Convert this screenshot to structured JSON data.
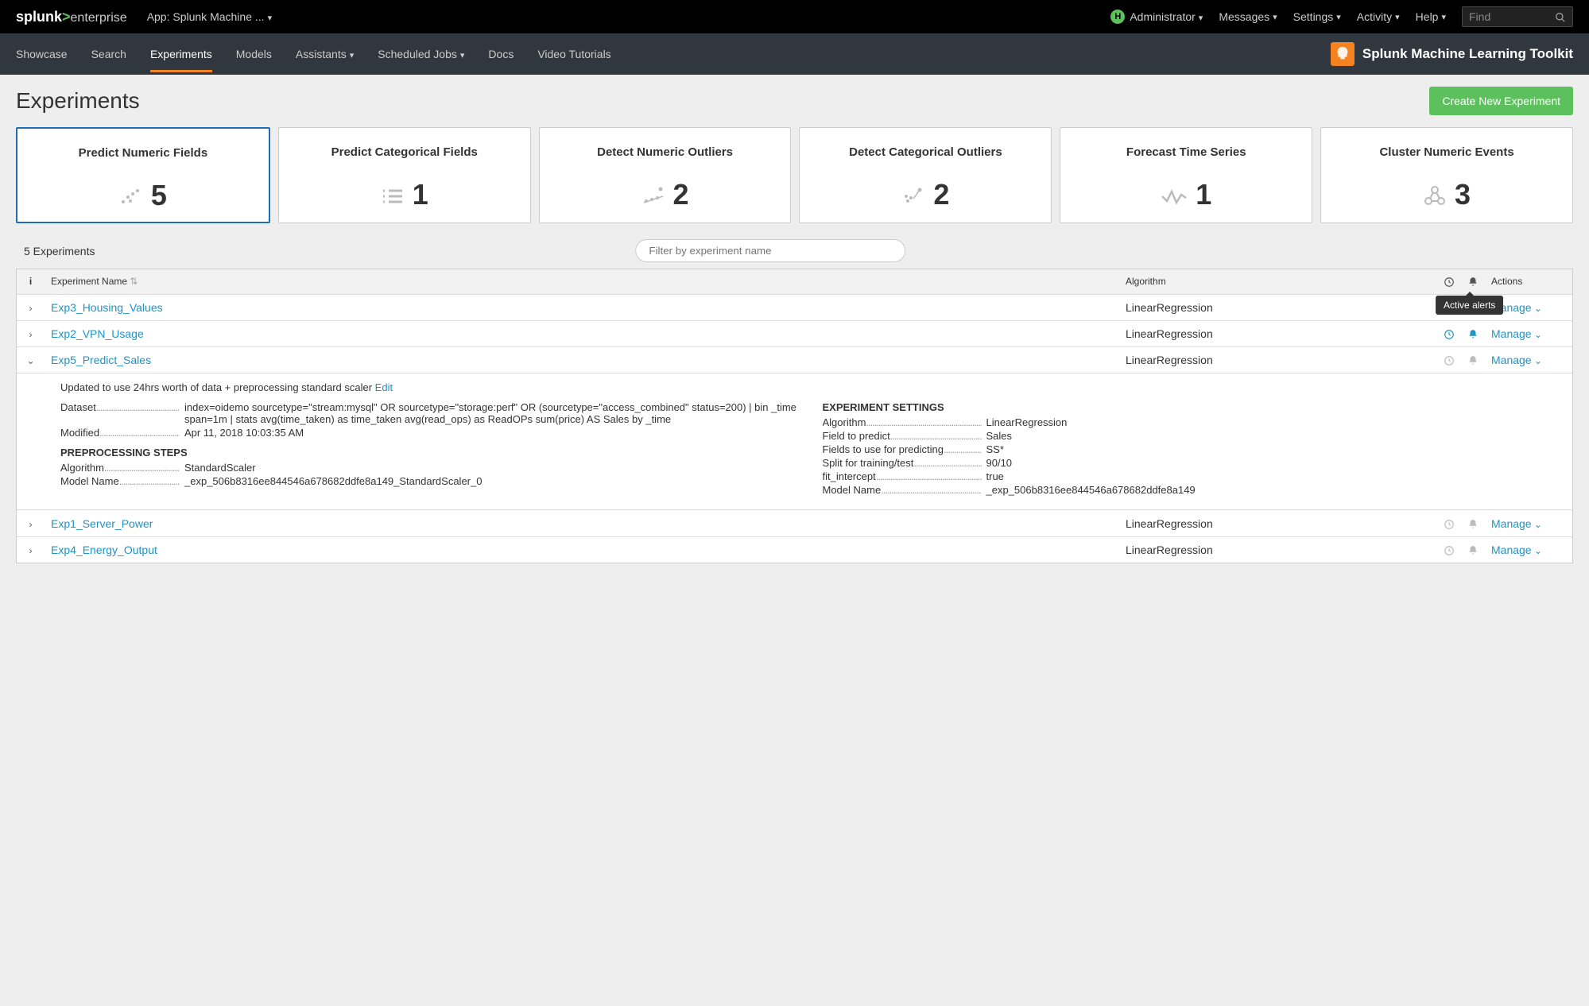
{
  "header": {
    "logo_main": "splunk",
    "logo_sym": ">",
    "logo_sub": "enterprise",
    "app_selector": "App: Splunk Machine ...",
    "admin_badge": "H",
    "menu": {
      "admin": "Administrator",
      "messages": "Messages",
      "settings": "Settings",
      "activity": "Activity",
      "help": "Help"
    },
    "find_placeholder": "Find"
  },
  "subnav": {
    "items": [
      "Showcase",
      "Search",
      "Experiments",
      "Models",
      "Assistants",
      "Scheduled Jobs",
      "Docs",
      "Video Tutorials"
    ],
    "product": "Splunk Machine Learning Toolkit"
  },
  "page": {
    "title": "Experiments",
    "create_button": "Create New Experiment",
    "experiments_count": "5 Experiments",
    "filter_placeholder": "Filter by experiment name"
  },
  "cards": [
    {
      "title": "Predict Numeric Fields",
      "count": "5"
    },
    {
      "title": "Predict Categorical Fields",
      "count": "1"
    },
    {
      "title": "Detect Numeric Outliers",
      "count": "2"
    },
    {
      "title": "Detect Categorical Outliers",
      "count": "2"
    },
    {
      "title": "Forecast Time Series",
      "count": "1"
    },
    {
      "title": "Cluster Numeric Events",
      "count": "3"
    }
  ],
  "table": {
    "headers": {
      "info": "i",
      "name": "Experiment Name",
      "algo": "Algorithm",
      "actions": "Actions"
    },
    "tooltip": "Active alerts",
    "manage_label": "Manage",
    "rows": [
      {
        "name": "Exp3_Housing_Values",
        "algo": "LinearRegression",
        "sched": false,
        "alert": false
      },
      {
        "name": "Exp2_VPN_Usage",
        "algo": "LinearRegression",
        "sched": true,
        "alert": true
      },
      {
        "name": "Exp5_Predict_Sales",
        "algo": "LinearRegression",
        "sched": false,
        "alert": false,
        "expanded": true
      },
      {
        "name": "Exp1_Server_Power",
        "algo": "LinearRegression",
        "sched": false,
        "alert": false
      },
      {
        "name": "Exp4_Energy_Output",
        "algo": "LinearRegression",
        "sched": false,
        "alert": false
      }
    ]
  },
  "expanded": {
    "note": "Updated to use 24hrs worth of data + preprocessing standard scaler",
    "edit": "Edit",
    "dataset_label": "Dataset",
    "dataset": "index=oidemo sourcetype=\"stream:mysql\" OR sourcetype=\"storage:perf\" OR (sourcetype=\"access_combined\" status=200) | bin _time span=1m | stats avg(time_taken) as time_taken avg(read_ops) as ReadOPs sum(price) AS Sales by _time",
    "modified_label": "Modified",
    "modified": "Apr 11, 2018 10:03:35 AM",
    "preproc_heading": "PREPROCESSING STEPS",
    "preproc_algo_label": "Algorithm",
    "preproc_algo": "StandardScaler",
    "preproc_model_label": "Model Name",
    "preproc_model": "_exp_506b8316ee844546a678682ddfe8a149_StandardScaler_0",
    "settings_heading": "EXPERIMENT SETTINGS",
    "settings": {
      "algo_label": "Algorithm",
      "algo": "LinearRegression",
      "field_label": "Field to predict",
      "field": "Sales",
      "fields_use_label": "Fields to use for predicting",
      "fields_use": "SS*",
      "split_label": "Split for training/test",
      "split": "90/10",
      "intercept_label": "fit_intercept",
      "intercept": "true",
      "model_label": "Model Name",
      "model": "_exp_506b8316ee844546a678682ddfe8a149"
    }
  }
}
